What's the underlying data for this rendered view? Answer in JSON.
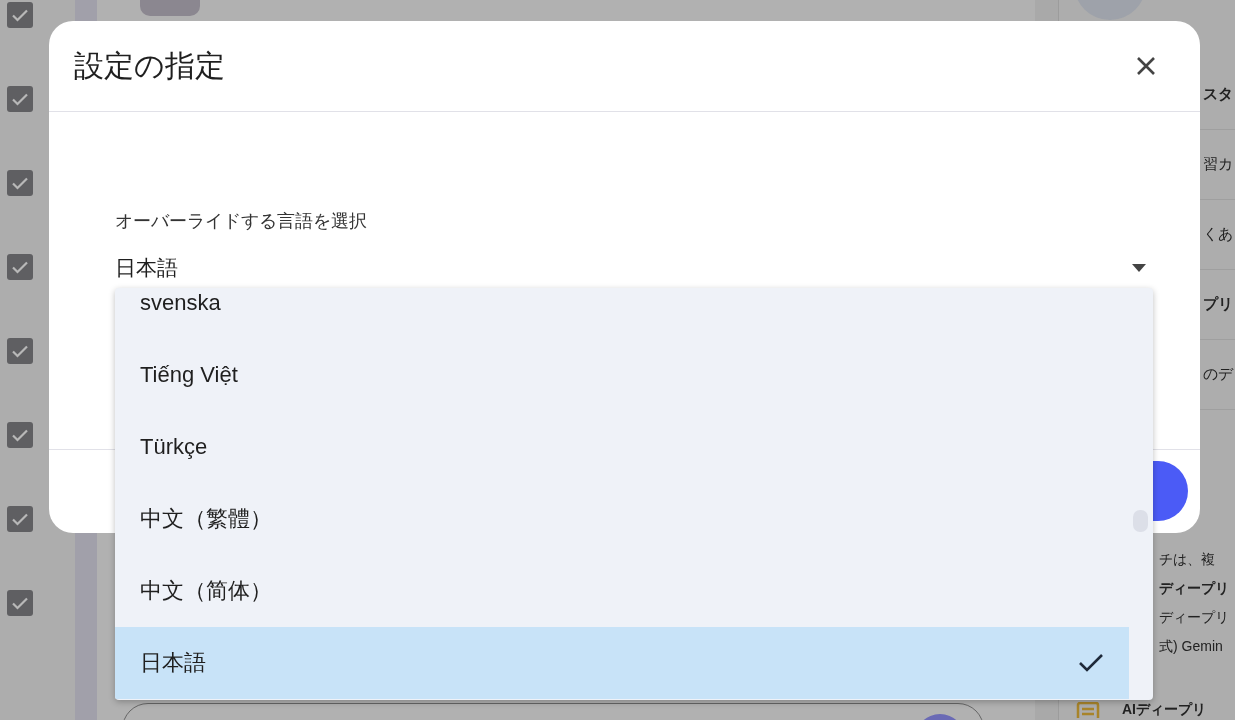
{
  "background": {
    "checkbox_rows": [
      {
        "checked": true
      },
      {
        "checked": true
      },
      {
        "checked": true
      },
      {
        "checked": true
      },
      {
        "checked": true
      },
      {
        "checked": true
      },
      {
        "checked": true
      },
      {
        "checked": true
      }
    ],
    "side_panel": {
      "upper": [
        {
          "text": "スタ",
          "bold": true
        },
        {
          "text": "習カ",
          "bold": false
        },
        {
          "text": "くあ",
          "bold": false
        },
        {
          "text": "プリ",
          "bold": true
        },
        {
          "text": "のデ",
          "bold": false
        }
      ],
      "lower": [
        {
          "text": "チは、複",
          "bold": false
        },
        {
          "text": "ディープリ",
          "bold": true
        },
        {
          "text": "ディープリ",
          "bold": false
        },
        {
          "text": "式) Gemin",
          "bold": false
        }
      ],
      "last": {
        "text": "AIディープリ",
        "bold": true
      }
    }
  },
  "dialog": {
    "title": "設定の指定",
    "field": {
      "label": "オーバーライドする言語を選択",
      "value": "日本語"
    },
    "menu": {
      "options": [
        {
          "label": "svenska",
          "selected": false
        },
        {
          "label": "Tiếng Việt",
          "selected": false
        },
        {
          "label": "Türkçe",
          "selected": false
        },
        {
          "label": "中文（繁體）",
          "selected": false
        },
        {
          "label": "中文（简体）",
          "selected": false
        },
        {
          "label": "日本語",
          "selected": true
        }
      ]
    }
  }
}
